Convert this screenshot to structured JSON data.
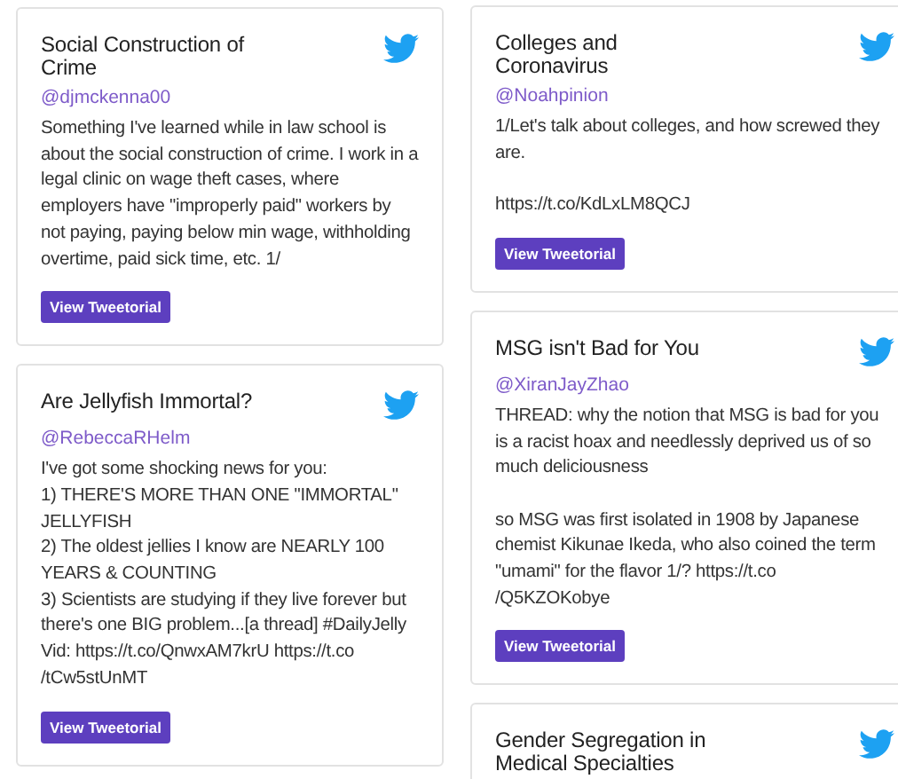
{
  "columns": [
    {
      "cards": [
        {
          "title": "Social Construction of Crime",
          "handle": "@djmckenna00",
          "text": "Something I've learned while in law school is about the social construction of crime. I work in a legal clinic on wage theft cases, where employers have \"improperly paid\" workers by not paying, paying below min wage, withholding overtime, paid sick time, etc. 1/",
          "button": "View Tweetorial"
        },
        {
          "title": "Are Jellyfish Immortal?",
          "handle": "@RebeccaRHelm",
          "text": "I've got some shocking news for you:\n1) THERE'S MORE THAN ONE \"IMMORTAL\" JELLYFISH\n2) The oldest jellies I know are NEARLY 100 YEARS & COUNTING\n3) Scientists are studying if they live forever but there's one BIG problem...[a thread] #DailyJelly\nVid: https://t.co/QnwxAM7krU https://t.co /tCw5stUnMT",
          "button": "View Tweetorial"
        }
      ]
    },
    {
      "cards": [
        {
          "title": "Colleges and Coronavirus",
          "handle": "@Noahpinion",
          "text": "1/Let's talk about colleges, and how screwed they are.\n\nhttps://t.co/KdLxLM8QCJ",
          "button": "View Tweetorial"
        },
        {
          "title": "MSG isn't Bad for You",
          "handle": "@XiranJayZhao",
          "text": "THREAD: why the notion that MSG is bad for you is a racist hoax and needlessly deprived us of so much deliciousness\n\nso MSG was first isolated in 1908 by Japanese chemist Kikunae Ikeda, who also coined the term \"umami\" for the flavor 1/? https://t.co /Q5KZOKobye",
          "button": "View Tweetorial"
        },
        {
          "title": "Gender Segregation in Medical Specialties"
        }
      ]
    }
  ]
}
